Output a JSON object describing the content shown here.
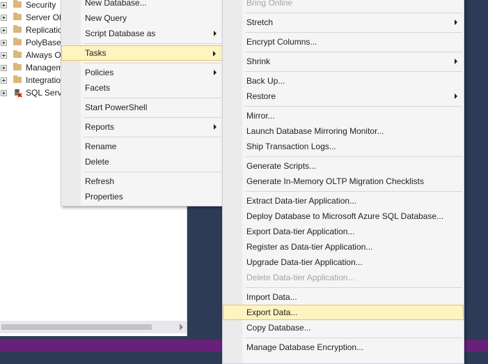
{
  "object_explorer": {
    "tree_items": [
      {
        "label": "Security",
        "icon": "folder-icon"
      },
      {
        "label": "Server Ob",
        "icon": "folder-icon"
      },
      {
        "label": "Replicatic",
        "icon": "folder-icon"
      },
      {
        "label": "PolyBase",
        "icon": "folder-icon"
      },
      {
        "label": "Always O",
        "icon": "folder-icon"
      },
      {
        "label": "Managem",
        "icon": "folder-icon"
      },
      {
        "label": "Integratio",
        "icon": "folder-icon"
      },
      {
        "label": "SQL Serve",
        "icon": "sql-agent-icon"
      }
    ]
  },
  "context_menu": {
    "items": {
      "new_database": "New Database...",
      "new_query": "New Query",
      "script_database_as": "Script Database as",
      "tasks": "Tasks",
      "policies": "Policies",
      "facets": "Facets",
      "start_powershell": "Start PowerShell",
      "reports": "Reports",
      "rename": "Rename",
      "delete": "Delete",
      "refresh": "Refresh",
      "properties": "Properties"
    },
    "highlighted": "Tasks"
  },
  "tasks_submenu": {
    "items": {
      "bring_online": "Bring Online",
      "stretch": "Stretch",
      "encrypt_columns": "Encrypt Columns...",
      "shrink": "Shrink",
      "back_up": "Back Up...",
      "restore": "Restore",
      "mirror": "Mirror...",
      "launch_mirroring_monitor": "Launch Database Mirroring Monitor...",
      "ship_transaction_logs": "Ship Transaction Logs...",
      "generate_scripts": "Generate Scripts...",
      "generate_inmemory": "Generate In-Memory OLTP Migration Checklists",
      "extract_dac": "Extract Data-tier Application...",
      "deploy_azure": "Deploy Database to Microsoft Azure SQL Database...",
      "export_dac": "Export Data-tier Application...",
      "register_dac": "Register as Data-tier Application...",
      "upgrade_dac": "Upgrade Data-tier Application...",
      "delete_dac": "Delete Data-tier Application...",
      "import_data": "Import Data...",
      "export_data": "Export Data...",
      "copy_database": "Copy Database...",
      "manage_encryption": "Manage Database Encryption..."
    },
    "highlighted": "Export Data..."
  },
  "colors": {
    "status_bar": "#68217a",
    "highlight_bg": "#fdf4bf",
    "highlight_border": "#e5c365",
    "workspace_bg": "#2e3b56"
  }
}
